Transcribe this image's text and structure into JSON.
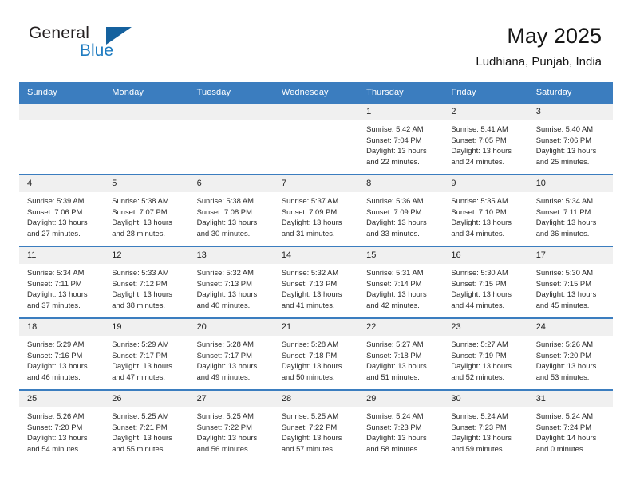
{
  "brand": {
    "name_part1": "General",
    "name_part2": "Blue",
    "triangle_color": "#15619e",
    "blue_color": "#1f7cc1"
  },
  "header": {
    "title": "May 2025",
    "subtitle": "Ludhiana, Punjab, India"
  },
  "theme": {
    "header_bg": "#3b7dbf",
    "header_text": "#ffffff",
    "daynum_bg": "#f0f0f0",
    "cell_border": "#3b7dbf"
  },
  "weekday_headers": [
    "Sunday",
    "Monday",
    "Tuesday",
    "Wednesday",
    "Thursday",
    "Friday",
    "Saturday"
  ],
  "labels": {
    "sunrise_prefix": "Sunrise:",
    "sunset_prefix": "Sunset:",
    "daylight_prefix": "Daylight:"
  },
  "weeks": [
    [
      {
        "day": "",
        "sunrise": "",
        "sunset": "",
        "daylight_line1": "",
        "daylight_line2": ""
      },
      {
        "day": "",
        "sunrise": "",
        "sunset": "",
        "daylight_line1": "",
        "daylight_line2": ""
      },
      {
        "day": "",
        "sunrise": "",
        "sunset": "",
        "daylight_line1": "",
        "daylight_line2": ""
      },
      {
        "day": "",
        "sunrise": "",
        "sunset": "",
        "daylight_line1": "",
        "daylight_line2": ""
      },
      {
        "day": "1",
        "sunrise": "Sunrise: 5:42 AM",
        "sunset": "Sunset: 7:04 PM",
        "daylight_line1": "Daylight: 13 hours",
        "daylight_line2": "and 22 minutes."
      },
      {
        "day": "2",
        "sunrise": "Sunrise: 5:41 AM",
        "sunset": "Sunset: 7:05 PM",
        "daylight_line1": "Daylight: 13 hours",
        "daylight_line2": "and 24 minutes."
      },
      {
        "day": "3",
        "sunrise": "Sunrise: 5:40 AM",
        "sunset": "Sunset: 7:06 PM",
        "daylight_line1": "Daylight: 13 hours",
        "daylight_line2": "and 25 minutes."
      }
    ],
    [
      {
        "day": "4",
        "sunrise": "Sunrise: 5:39 AM",
        "sunset": "Sunset: 7:06 PM",
        "daylight_line1": "Daylight: 13 hours",
        "daylight_line2": "and 27 minutes."
      },
      {
        "day": "5",
        "sunrise": "Sunrise: 5:38 AM",
        "sunset": "Sunset: 7:07 PM",
        "daylight_line1": "Daylight: 13 hours",
        "daylight_line2": "and 28 minutes."
      },
      {
        "day": "6",
        "sunrise": "Sunrise: 5:38 AM",
        "sunset": "Sunset: 7:08 PM",
        "daylight_line1": "Daylight: 13 hours",
        "daylight_line2": "and 30 minutes."
      },
      {
        "day": "7",
        "sunrise": "Sunrise: 5:37 AM",
        "sunset": "Sunset: 7:09 PM",
        "daylight_line1": "Daylight: 13 hours",
        "daylight_line2": "and 31 minutes."
      },
      {
        "day": "8",
        "sunrise": "Sunrise: 5:36 AM",
        "sunset": "Sunset: 7:09 PM",
        "daylight_line1": "Daylight: 13 hours",
        "daylight_line2": "and 33 minutes."
      },
      {
        "day": "9",
        "sunrise": "Sunrise: 5:35 AM",
        "sunset": "Sunset: 7:10 PM",
        "daylight_line1": "Daylight: 13 hours",
        "daylight_line2": "and 34 minutes."
      },
      {
        "day": "10",
        "sunrise": "Sunrise: 5:34 AM",
        "sunset": "Sunset: 7:11 PM",
        "daylight_line1": "Daylight: 13 hours",
        "daylight_line2": "and 36 minutes."
      }
    ],
    [
      {
        "day": "11",
        "sunrise": "Sunrise: 5:34 AM",
        "sunset": "Sunset: 7:11 PM",
        "daylight_line1": "Daylight: 13 hours",
        "daylight_line2": "and 37 minutes."
      },
      {
        "day": "12",
        "sunrise": "Sunrise: 5:33 AM",
        "sunset": "Sunset: 7:12 PM",
        "daylight_line1": "Daylight: 13 hours",
        "daylight_line2": "and 38 minutes."
      },
      {
        "day": "13",
        "sunrise": "Sunrise: 5:32 AM",
        "sunset": "Sunset: 7:13 PM",
        "daylight_line1": "Daylight: 13 hours",
        "daylight_line2": "and 40 minutes."
      },
      {
        "day": "14",
        "sunrise": "Sunrise: 5:32 AM",
        "sunset": "Sunset: 7:13 PM",
        "daylight_line1": "Daylight: 13 hours",
        "daylight_line2": "and 41 minutes."
      },
      {
        "day": "15",
        "sunrise": "Sunrise: 5:31 AM",
        "sunset": "Sunset: 7:14 PM",
        "daylight_line1": "Daylight: 13 hours",
        "daylight_line2": "and 42 minutes."
      },
      {
        "day": "16",
        "sunrise": "Sunrise: 5:30 AM",
        "sunset": "Sunset: 7:15 PM",
        "daylight_line1": "Daylight: 13 hours",
        "daylight_line2": "and 44 minutes."
      },
      {
        "day": "17",
        "sunrise": "Sunrise: 5:30 AM",
        "sunset": "Sunset: 7:15 PM",
        "daylight_line1": "Daylight: 13 hours",
        "daylight_line2": "and 45 minutes."
      }
    ],
    [
      {
        "day": "18",
        "sunrise": "Sunrise: 5:29 AM",
        "sunset": "Sunset: 7:16 PM",
        "daylight_line1": "Daylight: 13 hours",
        "daylight_line2": "and 46 minutes."
      },
      {
        "day": "19",
        "sunrise": "Sunrise: 5:29 AM",
        "sunset": "Sunset: 7:17 PM",
        "daylight_line1": "Daylight: 13 hours",
        "daylight_line2": "and 47 minutes."
      },
      {
        "day": "20",
        "sunrise": "Sunrise: 5:28 AM",
        "sunset": "Sunset: 7:17 PM",
        "daylight_line1": "Daylight: 13 hours",
        "daylight_line2": "and 49 minutes."
      },
      {
        "day": "21",
        "sunrise": "Sunrise: 5:28 AM",
        "sunset": "Sunset: 7:18 PM",
        "daylight_line1": "Daylight: 13 hours",
        "daylight_line2": "and 50 minutes."
      },
      {
        "day": "22",
        "sunrise": "Sunrise: 5:27 AM",
        "sunset": "Sunset: 7:18 PM",
        "daylight_line1": "Daylight: 13 hours",
        "daylight_line2": "and 51 minutes."
      },
      {
        "day": "23",
        "sunrise": "Sunrise: 5:27 AM",
        "sunset": "Sunset: 7:19 PM",
        "daylight_line1": "Daylight: 13 hours",
        "daylight_line2": "and 52 minutes."
      },
      {
        "day": "24",
        "sunrise": "Sunrise: 5:26 AM",
        "sunset": "Sunset: 7:20 PM",
        "daylight_line1": "Daylight: 13 hours",
        "daylight_line2": "and 53 minutes."
      }
    ],
    [
      {
        "day": "25",
        "sunrise": "Sunrise: 5:26 AM",
        "sunset": "Sunset: 7:20 PM",
        "daylight_line1": "Daylight: 13 hours",
        "daylight_line2": "and 54 minutes."
      },
      {
        "day": "26",
        "sunrise": "Sunrise: 5:25 AM",
        "sunset": "Sunset: 7:21 PM",
        "daylight_line1": "Daylight: 13 hours",
        "daylight_line2": "and 55 minutes."
      },
      {
        "day": "27",
        "sunrise": "Sunrise: 5:25 AM",
        "sunset": "Sunset: 7:22 PM",
        "daylight_line1": "Daylight: 13 hours",
        "daylight_line2": "and 56 minutes."
      },
      {
        "day": "28",
        "sunrise": "Sunrise: 5:25 AM",
        "sunset": "Sunset: 7:22 PM",
        "daylight_line1": "Daylight: 13 hours",
        "daylight_line2": "and 57 minutes."
      },
      {
        "day": "29",
        "sunrise": "Sunrise: 5:24 AM",
        "sunset": "Sunset: 7:23 PM",
        "daylight_line1": "Daylight: 13 hours",
        "daylight_line2": "and 58 minutes."
      },
      {
        "day": "30",
        "sunrise": "Sunrise: 5:24 AM",
        "sunset": "Sunset: 7:23 PM",
        "daylight_line1": "Daylight: 13 hours",
        "daylight_line2": "and 59 minutes."
      },
      {
        "day": "31",
        "sunrise": "Sunrise: 5:24 AM",
        "sunset": "Sunset: 7:24 PM",
        "daylight_line1": "Daylight: 14 hours",
        "daylight_line2": "and 0 minutes."
      }
    ]
  ]
}
